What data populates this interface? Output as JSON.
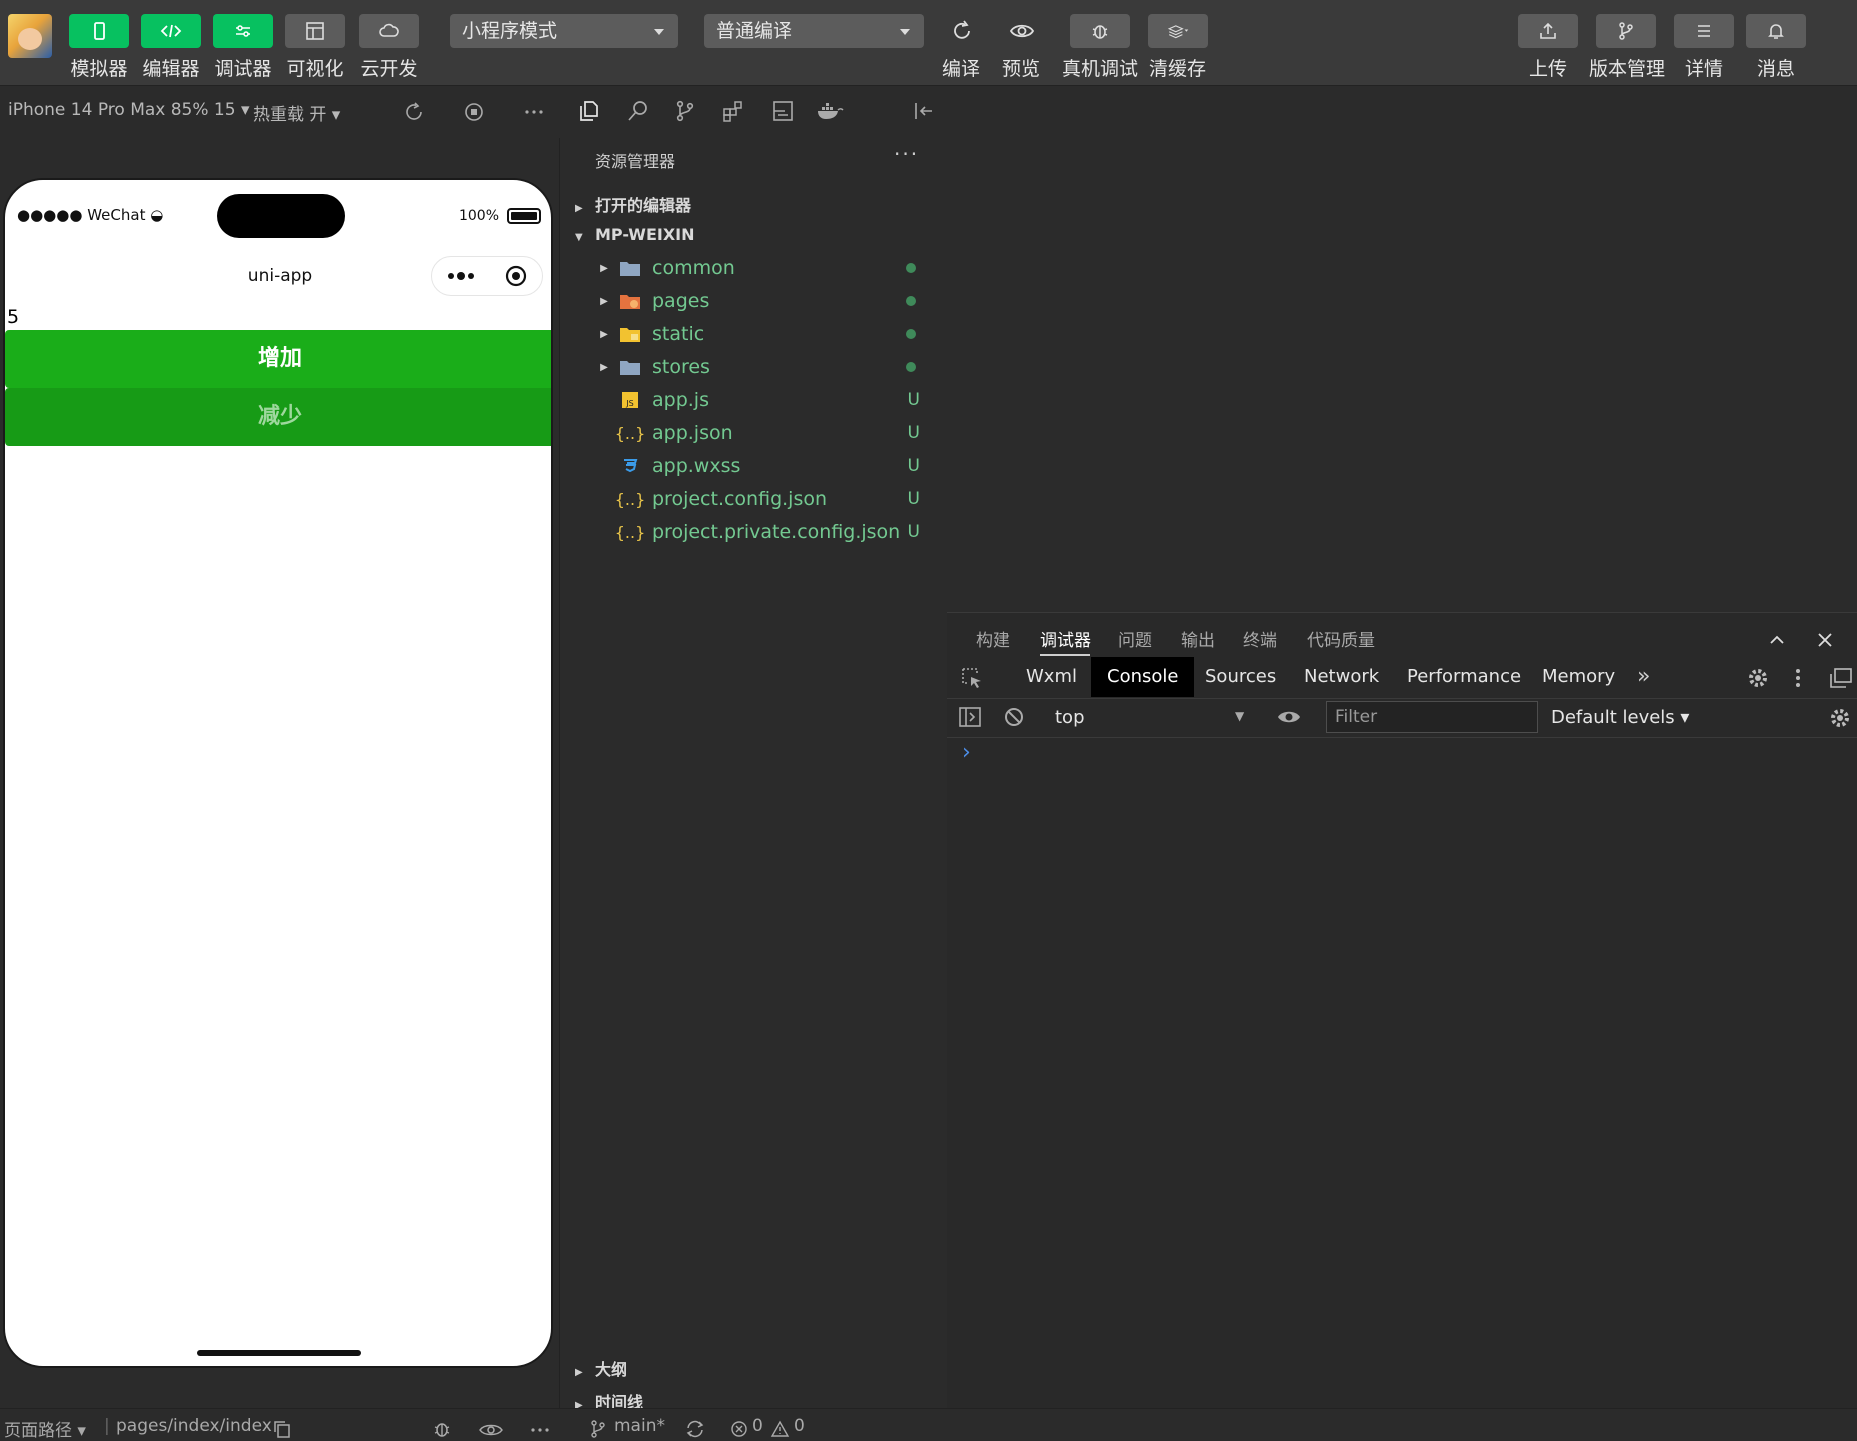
{
  "toolbar": {
    "simulator": "模拟器",
    "editor": "编辑器",
    "debugger": "调试器",
    "visual": "可视化",
    "cloud": "云开发",
    "mode_select": "小程序模式",
    "compile_select": "普通编译",
    "compile": "编译",
    "preview": "预览",
    "real_debug": "真机调试",
    "clear_cache": "清缓存",
    "upload": "上传",
    "version": "版本管理",
    "details": "详情",
    "messages": "消息"
  },
  "sim_toolbar": {
    "device": "iPhone 14 Pro Max 85% 15 ▾",
    "hot_reload": "热重载 开 ▾"
  },
  "phone": {
    "carrier": "●●●●● WeChat",
    "battery": "100%",
    "nav_title": "uni-app",
    "counter": "5",
    "add_button": "增加",
    "sub_button": "减少"
  },
  "explorer": {
    "title": "资源管理器",
    "more": "···",
    "open_editors": "打开的编辑器",
    "project": "MP-WEIXIN",
    "items": [
      {
        "name": "common",
        "status": ""
      },
      {
        "name": "pages",
        "status": ""
      },
      {
        "name": "static",
        "status": ""
      },
      {
        "name": "stores",
        "status": ""
      },
      {
        "name": "app.js",
        "status": "U"
      },
      {
        "name": "app.json",
        "status": "U"
      },
      {
        "name": "app.wxss",
        "status": "U"
      },
      {
        "name": "project.config.json",
        "status": "U"
      },
      {
        "name": "project.private.config.json",
        "status": "U"
      }
    ],
    "outline": "大纲",
    "timeline": "时间线"
  },
  "devtools": {
    "tabs": [
      "构建",
      "调试器",
      "问题",
      "输出",
      "终端",
      "代码质量"
    ],
    "panels": [
      "Wxml",
      "Console",
      "Sources",
      "Network",
      "Performance",
      "Memory"
    ],
    "context": "top",
    "filter_placeholder": "Filter",
    "levels": "Default levels ▾",
    "prompt": "›"
  },
  "statusbar": {
    "page_path_label": "页面路径 ▾",
    "page_path": "pages/index/index",
    "branch": "main*",
    "errors": "0",
    "warnings": "0"
  },
  "colors": {
    "accent_green": "#07c160",
    "button_green": "#1aad19",
    "file_green": "#73c991"
  }
}
